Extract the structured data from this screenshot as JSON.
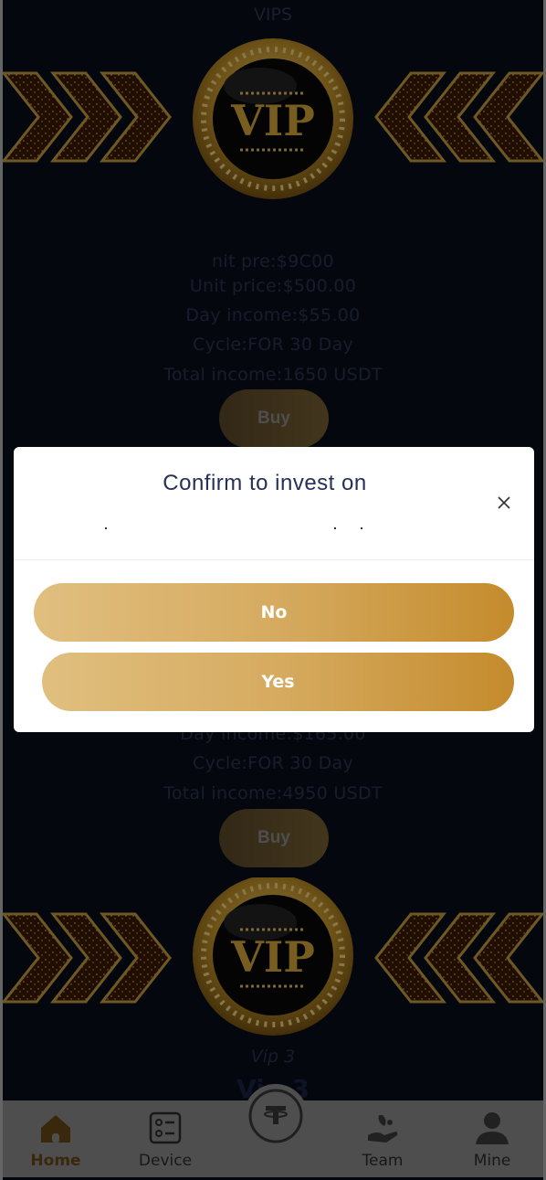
{
  "vip_section": {
    "top_title": "VIPS",
    "price_overlay_text": "nit pre:$9C00",
    "unit_price": "Unit price:$500.00",
    "day_income": "Day income:$55.00",
    "cycle": "Cycle:FOR 30 Day",
    "total_income": "Total income:1650 USDT",
    "buy_label": "Buy"
  },
  "vip_section_2": {
    "day_income": "Day income:$165.00",
    "cycle": "Cycle:FOR 30 Day",
    "total_income": "Total income:4950 USDT",
    "buy_label": "Buy"
  },
  "vip_3": {
    "italic_label": "Vip 3",
    "big_label": "Vip 3"
  },
  "badge_text": "VIP",
  "dialog": {
    "title": "Confirm to invest on",
    "no_label": "No",
    "yes_label": "Yes"
  },
  "tabbar": {
    "items": [
      {
        "label": "Home",
        "icon": "home-icon",
        "active": true
      },
      {
        "label": "Device",
        "icon": "device-icon",
        "active": false
      },
      {
        "label": "",
        "icon": "tether-icon",
        "active": false
      },
      {
        "label": "Team",
        "icon": "team-icon",
        "active": false
      },
      {
        "label": "Mine",
        "icon": "user-icon",
        "active": false
      }
    ]
  },
  "colors": {
    "background": "#090e1a",
    "gold_start": "#e0bf7f",
    "gold_end": "#c48b2c",
    "dialog_title": "#26305a",
    "tabbar": "#8e8e8e",
    "active_tab": "#6b4a16"
  }
}
